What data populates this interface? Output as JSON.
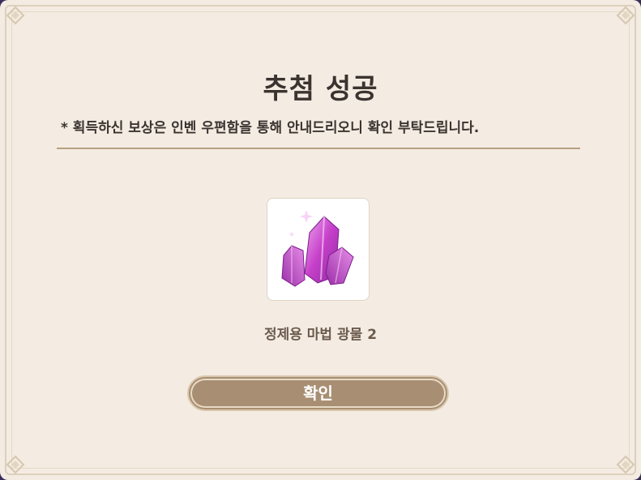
{
  "dialog": {
    "title": "추첨 성공",
    "notice": "* 획득하신 보상은 인벤 우편함을 통해 안내드리오니 확인 부탁드립니다.",
    "item": {
      "icon": "magic-crystal-icon",
      "name": "정제용 마법 광물 2"
    },
    "confirm_label": "확인"
  },
  "colors": {
    "background": "#f4ece2",
    "frame": "#ddd0bb",
    "divider": "#b79f82",
    "button": "#a88e72",
    "title_text": "#3a3330",
    "item_name_text": "#6b5a4e",
    "crystal": "#c13bc6"
  }
}
